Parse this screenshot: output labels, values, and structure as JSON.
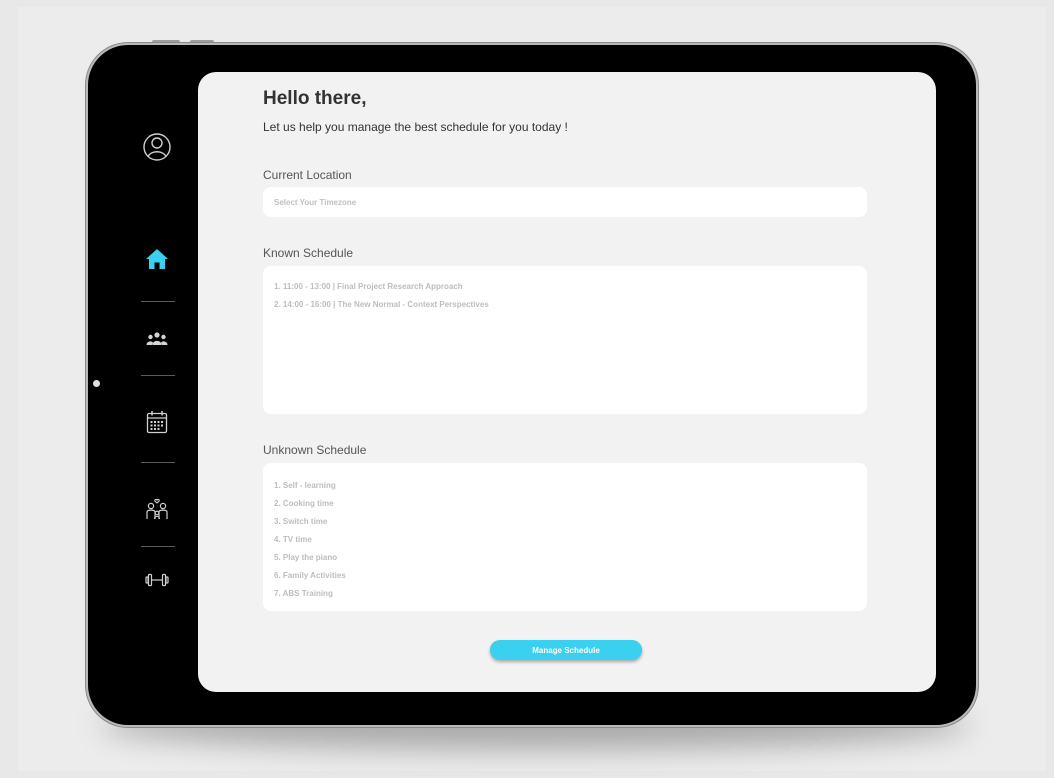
{
  "header": {
    "greeting": "Hello there,",
    "subtitle": "Let us help you manage the best schedule for you today !"
  },
  "location": {
    "label": "Current Location",
    "placeholder": "Select Your Timezone"
  },
  "known_schedule": {
    "label": "Known Schedule",
    "items": [
      "1. 11:00 - 13:00 | Final Project Research Approach",
      "2. 14:00 - 16:00 | The New Normal - Context Perspectives"
    ]
  },
  "unknown_schedule": {
    "label": "Unknown Schedule",
    "items": [
      "1. Self - learning",
      "2. Cooking time",
      "3. Switch time",
      "4. TV time",
      "5. Play the piano",
      "6. Family Activities",
      "7. ABS Training"
    ]
  },
  "actions": {
    "manage_label": "Manage Schedule"
  },
  "sidebar": {
    "items": [
      {
        "icon": "profile-icon",
        "active": false
      },
      {
        "icon": "home-icon",
        "active": true
      },
      {
        "icon": "group-icon",
        "active": false
      },
      {
        "icon": "calendar-icon",
        "active": false
      },
      {
        "icon": "family-icon",
        "active": false
      },
      {
        "icon": "dumbbell-icon",
        "active": false
      }
    ]
  },
  "colors": {
    "accent": "#3ad0f0",
    "device": "#000000",
    "screen": "#f2f2f2",
    "icon": "#cfcfcf"
  }
}
